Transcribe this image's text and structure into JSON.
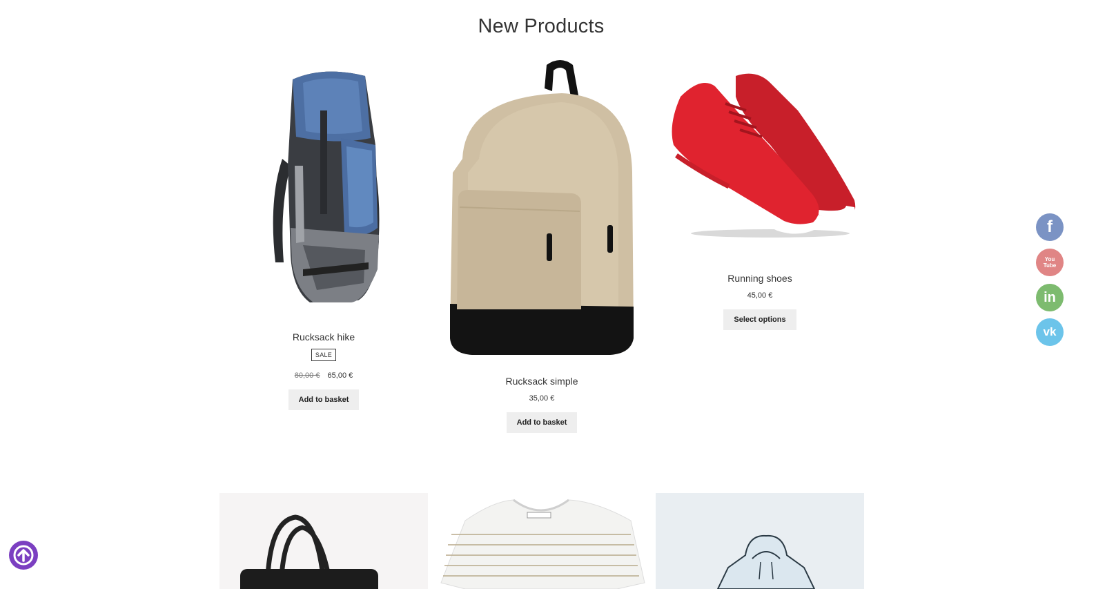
{
  "section": {
    "title": "New Products"
  },
  "products": [
    {
      "title": "Rucksack hike",
      "badge": "SALE",
      "old_price": "80,00 €",
      "price": "65,00 €",
      "button": "Add to basket",
      "image": "hiking-backpack-image"
    },
    {
      "title": "Rucksack simple",
      "price": "35,00 €",
      "button": "Add to basket",
      "image": "beige-backpack-image"
    },
    {
      "title": "Running shoes",
      "price": "45,00 €",
      "button": "Select options",
      "image": "red-running-shoes-image"
    }
  ],
  "social": [
    {
      "name": "facebook-icon",
      "label": "f",
      "color": "#7b93c4"
    },
    {
      "name": "youtube-icon",
      "label": "You Tube",
      "color": "#e08585"
    },
    {
      "name": "linkedin-icon",
      "label": "in",
      "color": "#7dbb6f"
    },
    {
      "name": "vk-icon",
      "label": "vk",
      "color": "#6cc4ea"
    }
  ],
  "scroll_top": {
    "icon": "arrow-up-icon",
    "color": "#7b3fc1"
  },
  "tiles": [
    {
      "name": "handbag-tile",
      "bg": "#f6f4f4"
    },
    {
      "name": "striped-tshirt-tile",
      "bg": "#ffffff"
    },
    {
      "name": "hoodie-tile",
      "bg": "#e9eef2"
    }
  ]
}
